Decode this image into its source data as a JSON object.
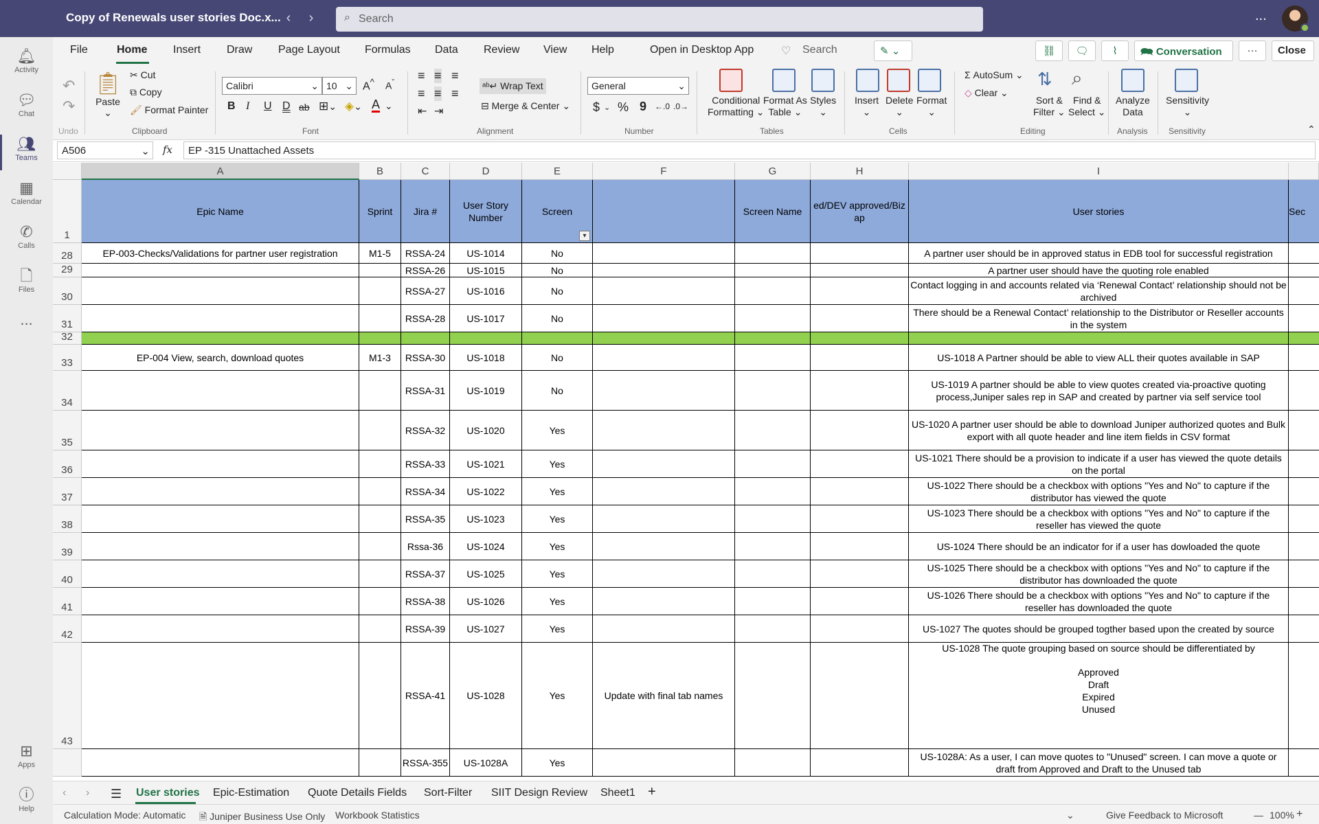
{
  "title_bar": {
    "doc_title": "Copy of Renewals user stories Doc.x...",
    "search_placeholder": "Search",
    "more": "..."
  },
  "rail": [
    {
      "label": "Activity",
      "icon": "bell-icon"
    },
    {
      "label": "Chat",
      "icon": "chat-icon"
    },
    {
      "label": "Teams",
      "icon": "teams-icon",
      "active": true
    },
    {
      "label": "Calendar",
      "icon": "calendar-icon"
    },
    {
      "label": "Calls",
      "icon": "phone-icon"
    },
    {
      "label": "Files",
      "icon": "file-icon"
    },
    {
      "label": "...",
      "icon": "more-icon"
    },
    {
      "label": "Apps",
      "icon": "apps-icon"
    },
    {
      "label": "Help",
      "icon": "help-icon"
    }
  ],
  "ribbon": {
    "tabs": [
      "File",
      "Home",
      "Insert",
      "Draw",
      "Page Layout",
      "Formulas",
      "Data",
      "Review",
      "View",
      "Help"
    ],
    "open_desktop": "Open in Desktop App",
    "search": "Search",
    "conversation": "Conversation",
    "close": "Close",
    "undo_group": "Undo",
    "clipboard": {
      "paste": "Paste",
      "cut": "Cut",
      "copy": "Copy",
      "format_painter": "Format Painter",
      "group": "Clipboard"
    },
    "font": {
      "name": "Calibri",
      "size": "10",
      "group": "Font",
      "bold": "B",
      "italic": "I",
      "underline": "U",
      "dunder": "D",
      "strike": "ab"
    },
    "alignment": {
      "wrap": "Wrap Text",
      "merge": "Merge & Center",
      "group": "Alignment"
    },
    "number": {
      "format": "General",
      "currency": "$",
      "percent": "%",
      "comma": "9",
      "group": "Number"
    },
    "tables": {
      "conditional": "Conditional",
      "conditional2": "Formatting",
      "format_as": "Format As",
      "format_as2": "Table",
      "styles": "Styles",
      "group": "Tables"
    },
    "cells": {
      "insert": "Insert",
      "delete": "Delete",
      "format": "Format",
      "group": "Cells"
    },
    "editing": {
      "autosum": "AutoSum",
      "clear": "Clear",
      "sort": "Sort &",
      "sort2": "Filter",
      "find": "Find &",
      "find2": "Select",
      "group": "Editing"
    },
    "analysis": {
      "analyze": "Analyze",
      "analyze2": "Data",
      "group": "Analysis"
    },
    "sensitivity": {
      "label": "Sensitivity",
      "group": "Sensitivity"
    }
  },
  "formula_bar": {
    "name_box": "A506",
    "fx": "fx",
    "formula": "EP -315 Unattached Assets"
  },
  "columns": [
    "A",
    "B",
    "C",
    "D",
    "E",
    "F",
    "G",
    "H",
    "I"
  ],
  "header_row": {
    "row": "1",
    "cells": [
      "Epic Name",
      "Sprint",
      "Jira #",
      "User Story Number",
      "Screen",
      "",
      "Screen Name",
      "ed/DEV approved/Biz ap",
      "User stories",
      "Sec"
    ]
  },
  "rows": [
    {
      "row": "28",
      "a": "EP-003-Checks/Validations for partner user registration",
      "b": "M1-5",
      "c": "RSSA-24",
      "d": "US-1014",
      "e": "No",
      "f": "",
      "i": "A partner user should be in approved status in EDB tool for successful registration"
    },
    {
      "row": "29",
      "a": "",
      "b": "",
      "c": "RSSA-26",
      "d": "US-1015",
      "e": "No",
      "f": "",
      "i": "A partner user should have the quoting role enabled"
    },
    {
      "row": "30",
      "a": "",
      "b": "",
      "c": "RSSA-27",
      "d": "US-1016",
      "e": "No",
      "f": "",
      "i": "Contact logging in and accounts related via ‘Renewal Contact’ relationship should not be archived"
    },
    {
      "row": "31",
      "a": "",
      "b": "",
      "c": "RSSA-28",
      "d": "US-1017",
      "e": "No",
      "f": "",
      "i": "There should be a Renewal Contact’ relationship to the Distributor or Reseller accounts in the system"
    },
    {
      "row": "32",
      "green": true
    },
    {
      "row": "33",
      "a": "EP-004  View, search, download quotes",
      "b": "M1-3",
      "c": "RSSA-30",
      "d": "US-1018",
      "e": "No",
      "f": "",
      "i": "US-1018 A Partner should be able to view ALL their quotes available in SAP"
    },
    {
      "row": "34",
      "a": "",
      "b": "",
      "c": "RSSA-31",
      "d": "US-1019",
      "e": "No",
      "f": "",
      "i": "US-1019 A partner should be able to view quotes created via-proactive quoting process,Juniper sales rep in SAP and created by partner via self service tool"
    },
    {
      "row": "35",
      "a": "",
      "b": "",
      "c": "RSSA-32",
      "d": "US-1020",
      "e": "Yes",
      "f": "",
      "i": "US-1020 A partner user should be able to download  Juniper authorized quotes and Bulk export with all quote header and line item fields in CSV format"
    },
    {
      "row": "36",
      "a": "",
      "b": "",
      "c": "RSSA-33",
      "d": "US-1021",
      "e": "Yes",
      "f": "",
      "i": "US-1021 There should be a provision to indicate if a user has viewed the quote details on the portal"
    },
    {
      "row": "37",
      "a": "",
      "b": "",
      "c": "RSSA-34",
      "d": "US-1022",
      "e": "Yes",
      "f": "",
      "i": "US-1022 There should be a checkbox with options \"Yes and No\" to capture if the distributor has viewed the quote"
    },
    {
      "row": "38",
      "a": "",
      "b": "",
      "c": "RSSA-35",
      "d": "US-1023",
      "e": "Yes",
      "f": "",
      "i": "US-1023 There should be a checkbox with options \"Yes and No\" to capture if the reseller has viewed the quote"
    },
    {
      "row": "39",
      "a": "",
      "b": "",
      "c": "Rssa-36",
      "d": "US-1024",
      "e": "Yes",
      "f": "",
      "i": "US-1024 There should be an indicator for if a user has dowloaded the quote"
    },
    {
      "row": "40",
      "a": "",
      "b": "",
      "c": "RSSA-37",
      "d": "US-1025",
      "e": "Yes",
      "f": "",
      "i": "US-1025 There should be a checkbox with options \"Yes and No\" to capture if the distributor has downloaded the quote"
    },
    {
      "row": "41",
      "a": "",
      "b": "",
      "c": "RSSA-38",
      "d": "US-1026",
      "e": "Yes",
      "f": "",
      "i": "US-1026 There should be a checkbox with options \"Yes and No\" to capture if the reseller has downloaded the quote"
    },
    {
      "row": "42",
      "a": "",
      "b": "",
      "c": "RSSA-39",
      "d": "US-1027",
      "e": "Yes",
      "f": "",
      "i": "US-1027 The quotes should be grouped togther based upon the created by source"
    },
    {
      "row": "43",
      "a": "",
      "b": "",
      "c": "RSSA-41",
      "d": "US-1028",
      "e": "Yes",
      "f": "Update with final tab names",
      "i": "US-1028 The quote grouping based on source should be differentiated by\n\nApproved\nDraft\nExpired\nUnused"
    },
    {
      "row": "",
      "a": "",
      "b": "",
      "c": "RSSA-355",
      "d": "US-1028A",
      "e": "Yes",
      "f": "",
      "i": "US-1028A:  As a user, I can move quotes to \"Unused\" screen.   I can move a quote or draft from Approved and Draft to the Unused tab"
    }
  ],
  "sheet_tabs": [
    "User stories",
    "Epic-Estimation",
    "Quote Details Fields",
    "Sort-Filter",
    "SIIT Design Review",
    "Sheet1"
  ],
  "status_bar": {
    "calc": "Calculation Mode: Automatic",
    "label": "Juniper Business Use Only",
    "stats": "Workbook Statistics",
    "feedback": "Give Feedback to Microsoft",
    "zoom": "100%",
    "minus": "—",
    "plus": "+"
  }
}
